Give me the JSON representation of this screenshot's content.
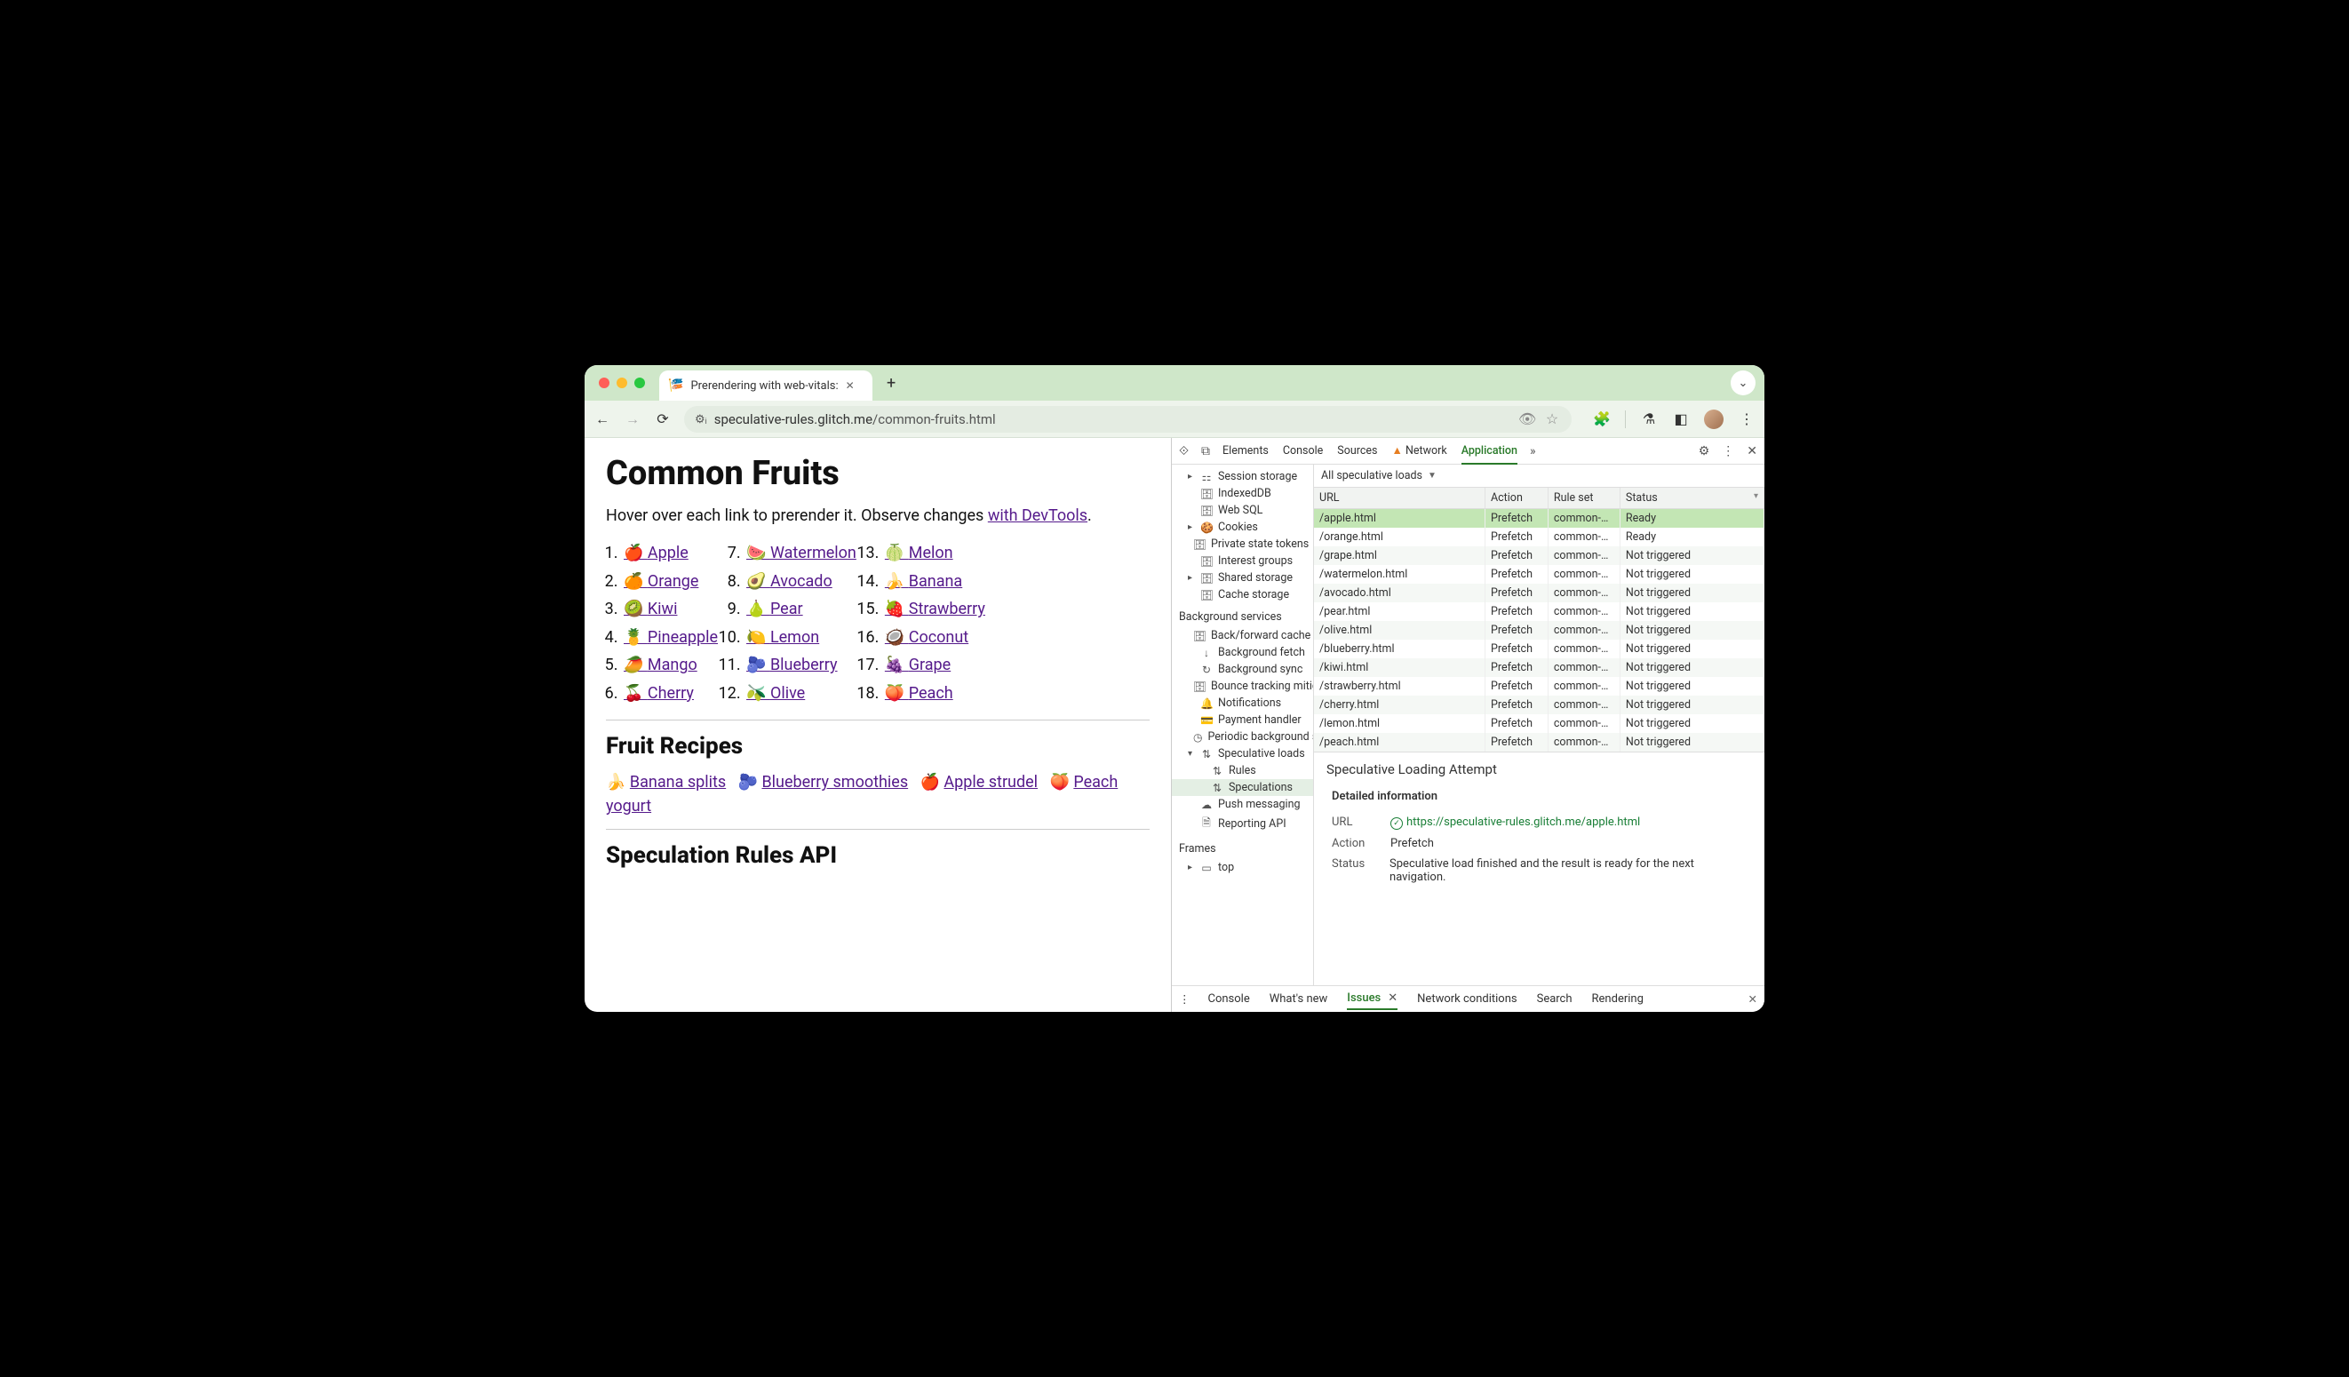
{
  "browser": {
    "tab_title": "Prerendering with web-vitals:",
    "url_host": "speculative-rules.glitch.me",
    "url_path": "/common-fruits.html"
  },
  "page": {
    "title": "Common Fruits",
    "intro_prefix": "Hover over each link to prerender it. Observe changes ",
    "intro_link": "with DevTools",
    "intro_suffix": ".",
    "fruits": [
      {
        "n": "1.",
        "e": "🍎",
        "t": "Apple"
      },
      {
        "n": "2.",
        "e": "🍊",
        "t": "Orange"
      },
      {
        "n": "3.",
        "e": "🥝",
        "t": "Kiwi"
      },
      {
        "n": "4.",
        "e": "🍍",
        "t": "Pineapple"
      },
      {
        "n": "5.",
        "e": "🥭",
        "t": "Mango"
      },
      {
        "n": "6.",
        "e": "🍒",
        "t": "Cherry"
      },
      {
        "n": "7.",
        "e": "🍉",
        "t": "Watermelon"
      },
      {
        "n": "8.",
        "e": "🥑",
        "t": "Avocado"
      },
      {
        "n": "9.",
        "e": "🍐",
        "t": "Pear"
      },
      {
        "n": "10.",
        "e": "🍋",
        "t": "Lemon"
      },
      {
        "n": "11.",
        "e": "🫐",
        "t": "Blueberry"
      },
      {
        "n": "12.",
        "e": "🫒",
        "t": "Olive"
      },
      {
        "n": "13.",
        "e": "🍈",
        "t": "Melon"
      },
      {
        "n": "14.",
        "e": "🍌",
        "t": "Banana"
      },
      {
        "n": "15.",
        "e": "🍓",
        "t": "Strawberry"
      },
      {
        "n": "16.",
        "e": "🥥",
        "t": "Coconut"
      },
      {
        "n": "17.",
        "e": "🍇",
        "t": "Grape"
      },
      {
        "n": "18.",
        "e": "🍑",
        "t": "Peach"
      }
    ],
    "recipes_heading": "Fruit Recipes",
    "recipes": [
      {
        "e": "🍌",
        "t": "Banana splits"
      },
      {
        "e": "🫐",
        "t": "Blueberry smoothies"
      },
      {
        "e": "🍎",
        "t": "Apple strudel"
      },
      {
        "e": "🍑",
        "t": "Peach yogurt"
      }
    ],
    "api_heading": "Speculation Rules API"
  },
  "devtools": {
    "panels": [
      "Elements",
      "Console",
      "Sources",
      "Network",
      "Application"
    ],
    "active_panel": "Application",
    "network_warn": true,
    "sidebar": {
      "storage": [
        {
          "t": "Session storage",
          "i": "⚏",
          "arrow": "▸"
        },
        {
          "t": "IndexedDB",
          "i": "🗄"
        },
        {
          "t": "Web SQL",
          "i": "🗄"
        },
        {
          "t": "Cookies",
          "i": "🍪",
          "arrow": "▸"
        },
        {
          "t": "Private state tokens",
          "i": "🗄"
        },
        {
          "t": "Interest groups",
          "i": "🗄"
        },
        {
          "t": "Shared storage",
          "i": "🗄",
          "arrow": "▸"
        },
        {
          "t": "Cache storage",
          "i": "🗄"
        }
      ],
      "bg_heading": "Background services",
      "bg": [
        {
          "t": "Back/forward cache",
          "i": "🗄"
        },
        {
          "t": "Background fetch",
          "i": "↓"
        },
        {
          "t": "Background sync",
          "i": "↻"
        },
        {
          "t": "Bounce tracking mitigations",
          "i": "🗄"
        },
        {
          "t": "Notifications",
          "i": "🔔"
        },
        {
          "t": "Payment handler",
          "i": "💳"
        },
        {
          "t": "Periodic background sync",
          "i": "◷"
        },
        {
          "t": "Speculative loads",
          "i": "⇅",
          "arrow": "▾",
          "children": [
            {
              "t": "Rules",
              "i": "⇅"
            },
            {
              "t": "Speculations",
              "i": "⇅",
              "selected": true
            }
          ]
        },
        {
          "t": "Push messaging",
          "i": "☁"
        },
        {
          "t": "Reporting API",
          "i": "🗎"
        }
      ],
      "frames_heading": "Frames",
      "frames": [
        {
          "t": "top",
          "i": "▭",
          "arrow": "▸"
        }
      ]
    },
    "filter_label": "All speculative loads",
    "table": {
      "cols": [
        "URL",
        "Action",
        "Rule set",
        "Status"
      ],
      "rows": [
        {
          "url": "/apple.html",
          "action": "Prefetch",
          "rule": "common-…",
          "status": "Ready",
          "hl": true
        },
        {
          "url": "/orange.html",
          "action": "Prefetch",
          "rule": "common-…",
          "status": "Ready"
        },
        {
          "url": "/grape.html",
          "action": "Prefetch",
          "rule": "common-…",
          "status": "Not triggered"
        },
        {
          "url": "/watermelon.html",
          "action": "Prefetch",
          "rule": "common-…",
          "status": "Not triggered"
        },
        {
          "url": "/avocado.html",
          "action": "Prefetch",
          "rule": "common-…",
          "status": "Not triggered"
        },
        {
          "url": "/pear.html",
          "action": "Prefetch",
          "rule": "common-…",
          "status": "Not triggered"
        },
        {
          "url": "/olive.html",
          "action": "Prefetch",
          "rule": "common-…",
          "status": "Not triggered"
        },
        {
          "url": "/blueberry.html",
          "action": "Prefetch",
          "rule": "common-…",
          "status": "Not triggered"
        },
        {
          "url": "/kiwi.html",
          "action": "Prefetch",
          "rule": "common-…",
          "status": "Not triggered"
        },
        {
          "url": "/strawberry.html",
          "action": "Prefetch",
          "rule": "common-…",
          "status": "Not triggered"
        },
        {
          "url": "/cherry.html",
          "action": "Prefetch",
          "rule": "common-…",
          "status": "Not triggered"
        },
        {
          "url": "/lemon.html",
          "action": "Prefetch",
          "rule": "common-…",
          "status": "Not triggered"
        },
        {
          "url": "/peach.html",
          "action": "Prefetch",
          "rule": "common-…",
          "status": "Not triggered"
        }
      ]
    },
    "detail": {
      "title": "Speculative Loading Attempt",
      "section": "Detailed information",
      "url_label": "URL",
      "url_value": "https://speculative-rules.glitch.me/apple.html",
      "action_label": "Action",
      "action_value": "Prefetch",
      "status_label": "Status",
      "status_value": "Speculative load finished and the result is ready for the next navigation."
    },
    "drawer": {
      "tabs": [
        "Console",
        "What's new",
        "Issues",
        "Network conditions",
        "Search",
        "Rendering"
      ],
      "active": "Issues"
    }
  }
}
